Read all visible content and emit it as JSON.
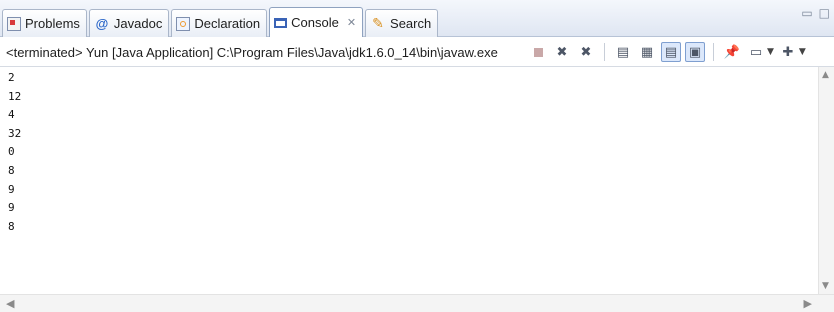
{
  "tabs": [
    {
      "label": "Problems",
      "icon": "problems-icon"
    },
    {
      "label": "Javadoc",
      "icon": "javadoc-icon"
    },
    {
      "label": "Declaration",
      "icon": "declaration-icon"
    },
    {
      "label": "Console",
      "icon": "console-icon",
      "active": true,
      "close": "✕"
    },
    {
      "label": "Search",
      "icon": "search-icon"
    }
  ],
  "status_line": "<terminated> Yun [Java Application] C:\\Program Files\\Java\\jdk1.6.0_14\\bin\\javaw.exe",
  "toolbar": [
    "terminate-icon",
    "remove-launch-icon",
    "remove-all-terminated-icon",
    "scroll-lock-icon",
    "word-wrap-icon",
    "show-console-on-stdout-icon",
    "show-console-on-stderr-icon",
    "pin-console-icon",
    "display-selected-console-icon",
    "open-console-icon"
  ],
  "output": [
    "2",
    "12",
    "4",
    "32",
    "0",
    "8",
    "9",
    "9",
    "8"
  ]
}
